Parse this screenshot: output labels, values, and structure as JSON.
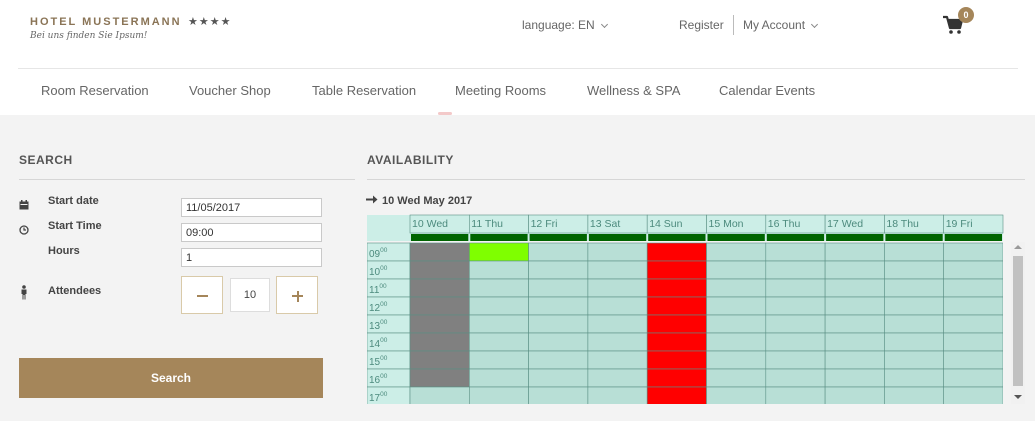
{
  "brand": {
    "name": "HOTEL MUSTERMANN",
    "stars": "★★★★",
    "tagline": "Bei uns finden Sie Ipsum!"
  },
  "header": {
    "language": "language: EN",
    "register": "Register",
    "account": "My Account",
    "cart_count": "0"
  },
  "nav": {
    "items": [
      "Room Reservation",
      "Voucher Shop",
      "Table Reservation",
      "Meeting Rooms",
      "Wellness & SPA",
      "Calendar Events"
    ]
  },
  "search": {
    "title": "SEARCH",
    "start_date_label": "Start date",
    "start_date_value": "11/05/2017",
    "start_time_label": "Start Time",
    "start_time_value": "09:00",
    "hours_label": "Hours",
    "hours_value": "1",
    "attendees_label": "Attendees",
    "attendees_value": "10",
    "minus": "−",
    "plus": "+",
    "button": "Search"
  },
  "availability": {
    "title": "AVAILABILITY",
    "week_label": "10 Wed May 2017",
    "days": [
      "10 Wed",
      "11 Thu",
      "12 Fri",
      "13 Sat",
      "14 Sun",
      "15 Mon",
      "16 Thu",
      "17 Wed",
      "18 Thu",
      "19 Fri"
    ],
    "hours": [
      "09",
      "10",
      "11",
      "12",
      "13",
      "14",
      "15",
      "16",
      "17"
    ],
    "hour_suffix": "00",
    "colors": {
      "free": "#b8dfd6",
      "past": "#808080",
      "selected": "#7fff00",
      "blocked": "#ff0000",
      "header": "#cceee7",
      "header_bar": "#006400",
      "grid": "#5a8f84"
    },
    "cells": [
      [
        "past",
        "selected",
        "free",
        "free",
        "blocked",
        "free",
        "free",
        "free",
        "free",
        "free"
      ],
      [
        "past",
        "free",
        "free",
        "free",
        "blocked",
        "free",
        "free",
        "free",
        "free",
        "free"
      ],
      [
        "past",
        "free",
        "free",
        "free",
        "blocked",
        "free",
        "free",
        "free",
        "free",
        "free"
      ],
      [
        "past",
        "free",
        "free",
        "free",
        "blocked",
        "free",
        "free",
        "free",
        "free",
        "free"
      ],
      [
        "past",
        "free",
        "free",
        "free",
        "blocked",
        "free",
        "free",
        "free",
        "free",
        "free"
      ],
      [
        "past",
        "free",
        "free",
        "free",
        "blocked",
        "free",
        "free",
        "free",
        "free",
        "free"
      ],
      [
        "past",
        "free",
        "free",
        "free",
        "blocked",
        "free",
        "free",
        "free",
        "free",
        "free"
      ],
      [
        "past",
        "free",
        "free",
        "free",
        "blocked",
        "free",
        "free",
        "free",
        "free",
        "free"
      ],
      [
        "free",
        "free",
        "free",
        "free",
        "blocked",
        "free",
        "free",
        "free",
        "free",
        "free"
      ]
    ]
  }
}
